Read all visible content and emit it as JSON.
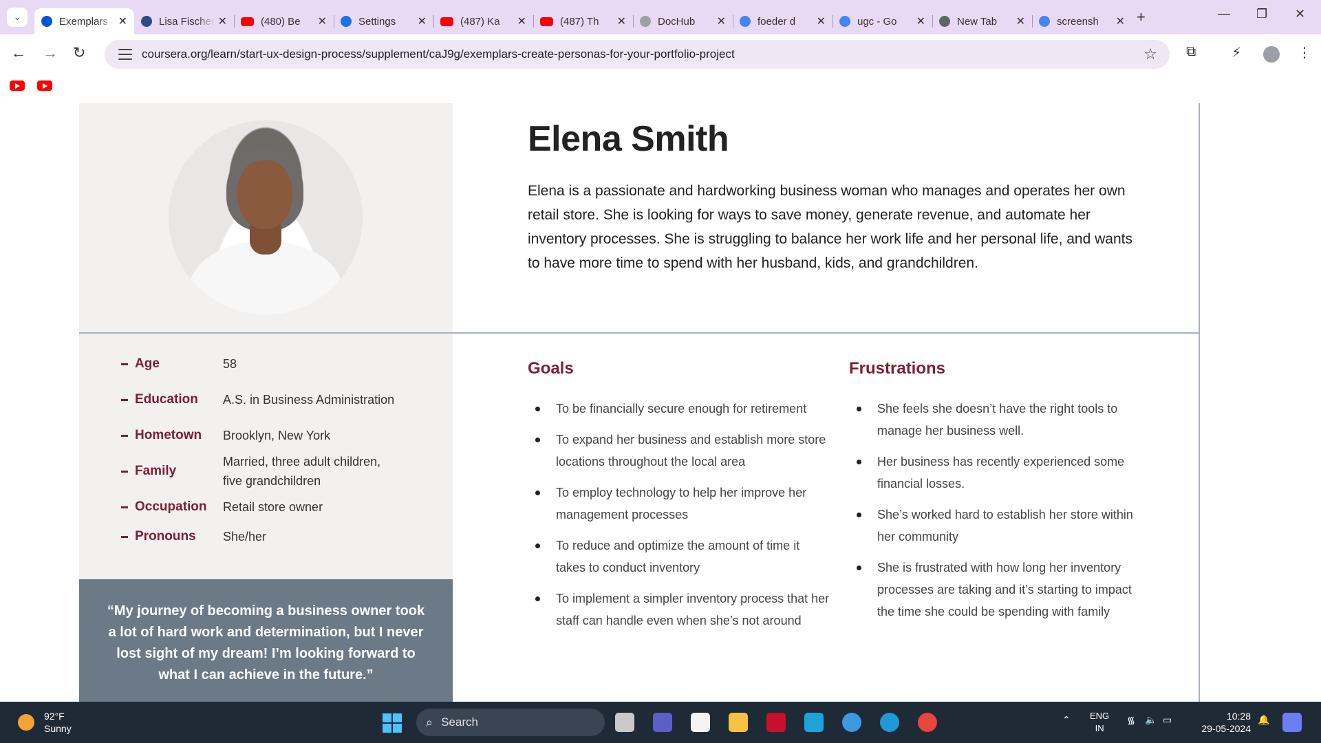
{
  "browser": {
    "tabs": [
      {
        "title": "Exemplars - Create personas",
        "active": true,
        "icon": "coursera-icon"
      },
      {
        "title": "Lisa Fischer",
        "active": false,
        "icon": "flag-icon"
      },
      {
        "title": "(480) Be",
        "active": false,
        "icon": "youtube-icon"
      },
      {
        "title": "Settings",
        "active": false,
        "icon": "gear-icon"
      },
      {
        "title": "(487) Ka",
        "active": false,
        "icon": "youtube-icon"
      },
      {
        "title": "(487) Th",
        "active": false,
        "icon": "youtube-icon"
      },
      {
        "title": "DocHub",
        "active": false,
        "icon": "globe-icon"
      },
      {
        "title": "foeder d",
        "active": false,
        "icon": "google-icon"
      },
      {
        "title": "ugc - Go",
        "active": false,
        "icon": "google-icon"
      },
      {
        "title": "New Tab",
        "active": false,
        "icon": "chrome-icon"
      },
      {
        "title": "screensh",
        "active": false,
        "icon": "google-icon"
      }
    ],
    "url": "coursera.org/learn/start-ux-design-process/supplement/caJ9g/exemplars-create-personas-for-your-portfolio-project"
  },
  "persona": {
    "name": "Elena Smith",
    "bio": "Elena is a passionate and hardworking business woman who manages and operates her own retail store. She is looking for ways to save money, generate revenue, and automate her inventory processes. She is struggling to balance her work life and her personal life, and wants to have more time to spend with her husband, kids, and grandchildren.",
    "details": [
      {
        "label": "Age",
        "value": "58"
      },
      {
        "label": "Education",
        "value": "A.S. in Business Administration"
      },
      {
        "label": "Hometown",
        "value": "Brooklyn, New York"
      },
      {
        "label": "Family",
        "value": "Married, three adult children, five grandchildren"
      },
      {
        "label": "Occupation",
        "value": "Retail store owner"
      },
      {
        "label": "Pronouns",
        "value": "She/her"
      }
    ],
    "quote": "“My journey of becoming a business owner took a lot of hard work and determination, but I never lost sight of my dream!  I’m looking forward to what I can achieve in the future.”",
    "goals_title": "Goals",
    "goals": [
      "To be financially secure enough for retirement",
      "To expand her business and establish more store locations throughout the local area",
      "To employ technology to help her improve her management processes",
      "To reduce and optimize the amount of time it takes to conduct inventory",
      "To implement a simpler inventory process that her staff can handle even when she’s not around"
    ],
    "frustrations_title": "Frustrations",
    "frustrations": [
      "She feels she doesn’t have the right tools to manage her business well.",
      "Her business has recently experienced some financial losses.",
      "She’s worked hard to establish her store within her community",
      "She is frustrated with how long her inventory processes are taking and it’s starting to impact the time she could be spending with family"
    ],
    "colors": {
      "accent": "#7d1e35",
      "quote_bg": "#6b7a86",
      "panel_bg": "#f2f1f0"
    }
  },
  "taskbar": {
    "weather_temp": "92°F",
    "weather_desc": "Sunny",
    "search_label": "Search",
    "lang_top": "ENG",
    "lang_bottom": "IN",
    "time": "10:28",
    "date": "29-05-2024"
  }
}
